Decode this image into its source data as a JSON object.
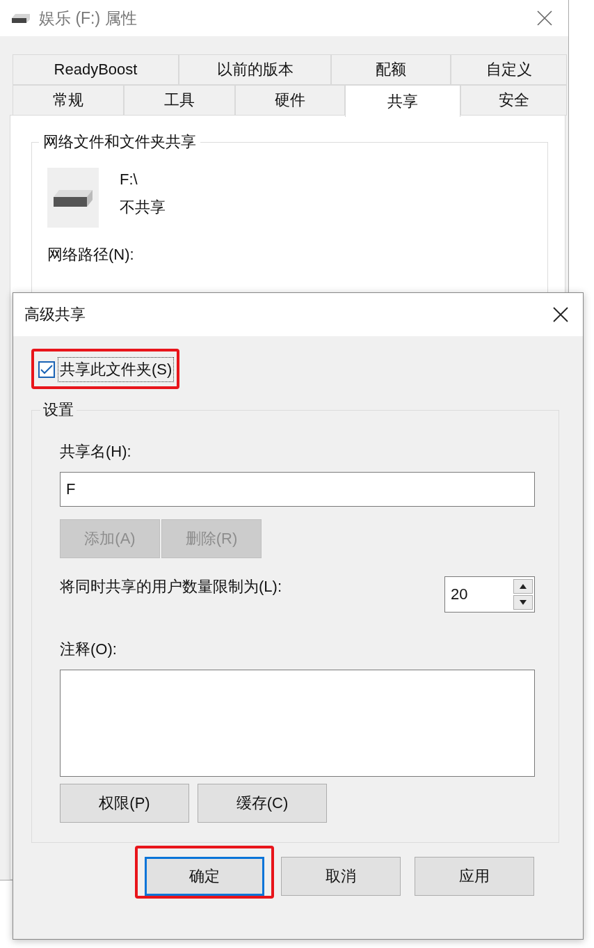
{
  "window": {
    "title": "娱乐 (F:) 属性"
  },
  "tab_rows": [
    {
      "tabs": [
        {
          "label": "ReadyBoost",
          "selected": false
        },
        {
          "label": "以前的版本",
          "selected": false
        },
        {
          "label": "配额",
          "selected": false
        },
        {
          "label": "自定义",
          "selected": false
        }
      ]
    },
    {
      "tabs": [
        {
          "label": "常规",
          "selected": false
        },
        {
          "label": "工具",
          "selected": false
        },
        {
          "label": "硬件",
          "selected": false
        },
        {
          "label": "共享",
          "selected": true
        },
        {
          "label": "安全",
          "selected": false
        }
      ]
    }
  ],
  "sharing_group": {
    "title": "网络文件和文件夹共享",
    "drive_name": "F:\\",
    "status": "不共享",
    "network_path_label": "网络路径(N):"
  },
  "dialog": {
    "title": "高级共享",
    "share_checkbox": {
      "label": "共享此文件夹(S)",
      "checked": true,
      "highlighted": true
    },
    "settings": {
      "title": "设置",
      "share_name_label": "共享名(H):",
      "share_name_value": "F",
      "name_buttons": [
        {
          "label": "添加(A)",
          "disabled": true
        },
        {
          "label": "删除(R)",
          "disabled": true
        }
      ],
      "user_limit_label": "将同时共享的用户数量限制为(L):",
      "user_limit_value": "20",
      "comment_label": "注释(O):",
      "bottom_buttons": [
        {
          "label": "权限(P)",
          "disabled": false
        },
        {
          "label": "缓存(C)",
          "disabled": false
        }
      ]
    },
    "footer_buttons": [
      {
        "label": "确定",
        "default": true,
        "highlighted": true
      },
      {
        "label": "取消",
        "default": false,
        "highlighted": false
      },
      {
        "label": "应用",
        "default": false,
        "highlighted": false
      }
    ]
  }
}
